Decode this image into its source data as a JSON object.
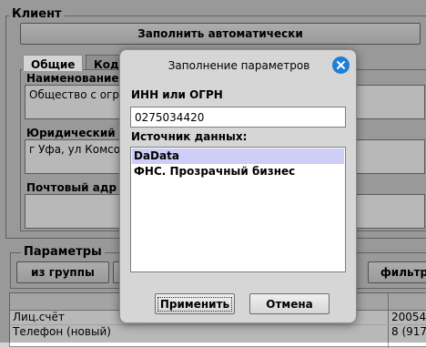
{
  "client": {
    "legend": "Клиент",
    "autofill_button": "Заполнить автоматически",
    "tabs": [
      "Общие",
      "Код"
    ],
    "name_label": "Наименование",
    "name_value": "Общество с огр",
    "legal_label": "Юридический",
    "legal_value": "г Уфа, ул Комсо",
    "postal_label": "Почтовый адр"
  },
  "params": {
    "legend": "Параметры",
    "from_group_button": "из группы",
    "filter_button": "фильтр"
  },
  "table": {
    "rows": [
      {
        "name": "Лиц.счёт",
        "value": "20054"
      },
      {
        "name": "Телефон (новый)",
        "value": "8 (917"
      }
    ]
  },
  "dialog": {
    "title": "Заполнение параметров",
    "inn_label": "ИНН или ОГРН",
    "inn_value": "0275034420",
    "source_label": "Источник данных:",
    "sources": [
      "DaData",
      "ФНС. Прозрачный бизнес"
    ],
    "selected_index": 0,
    "apply_button": "Применить",
    "cancel_button": "Отмена"
  },
  "colors": {
    "dialog_bg": "#d6d6d6",
    "selection": "#cdcdf5",
    "close_icon": "#1f7fd6"
  }
}
